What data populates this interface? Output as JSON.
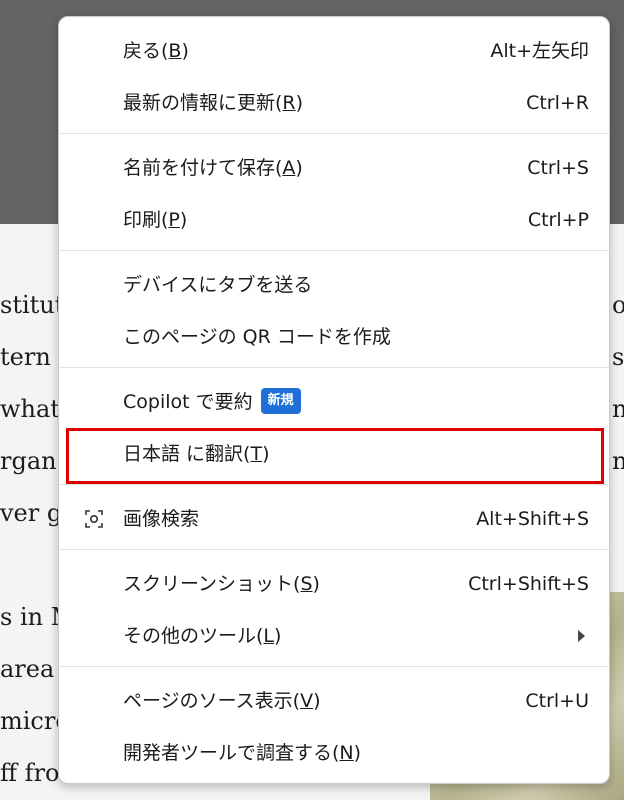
{
  "background": {
    "left_lines": [
      "stitut",
      "tern",
      "what",
      "rgan",
      "ver go",
      "s in M",
      "area",
      "micro",
      "ff fro"
    ],
    "right_lines": [
      "or",
      "s",
      "n.",
      "n"
    ]
  },
  "menu": {
    "back": {
      "label": "戻る(",
      "key": "B",
      "tail": ")",
      "shortcut": "Alt+左矢印"
    },
    "refresh": {
      "label": "最新の情報に更新(",
      "key": "R",
      "tail": ")",
      "shortcut": "Ctrl+R"
    },
    "save": {
      "label": "名前を付けて保存(",
      "key": "A",
      "tail": ")",
      "shortcut": "Ctrl+S"
    },
    "print": {
      "label": "印刷(",
      "key": "P",
      "tail": ")",
      "shortcut": "Ctrl+P"
    },
    "send_tab": {
      "label": "デバイスにタブを送る"
    },
    "qr": {
      "label": "このページの QR コードを作成"
    },
    "copilot": {
      "label": "Copilot で要約",
      "badge": "新規"
    },
    "translate": {
      "label": "日本語 に翻訳(",
      "key": "T",
      "tail": ")"
    },
    "image_search": {
      "label": "画像検索",
      "shortcut": "Alt+Shift+S",
      "icon": "visual-search-icon"
    },
    "screenshot": {
      "label": "スクリーンショット(",
      "key": "S",
      "tail": ")",
      "shortcut": "Ctrl+Shift+S"
    },
    "more_tools": {
      "label": "その他のツール(",
      "key": "L",
      "tail": ")",
      "icon": "chevron-right-icon"
    },
    "view_source": {
      "label": "ページのソース表示(",
      "key": "V",
      "tail": ")",
      "shortcut": "Ctrl+U"
    },
    "inspect": {
      "label": "開発者ツールで調査する(",
      "key": "N",
      "tail": ")"
    }
  },
  "colors": {
    "highlight": "#e00000",
    "badge": "#1f6fd8"
  }
}
